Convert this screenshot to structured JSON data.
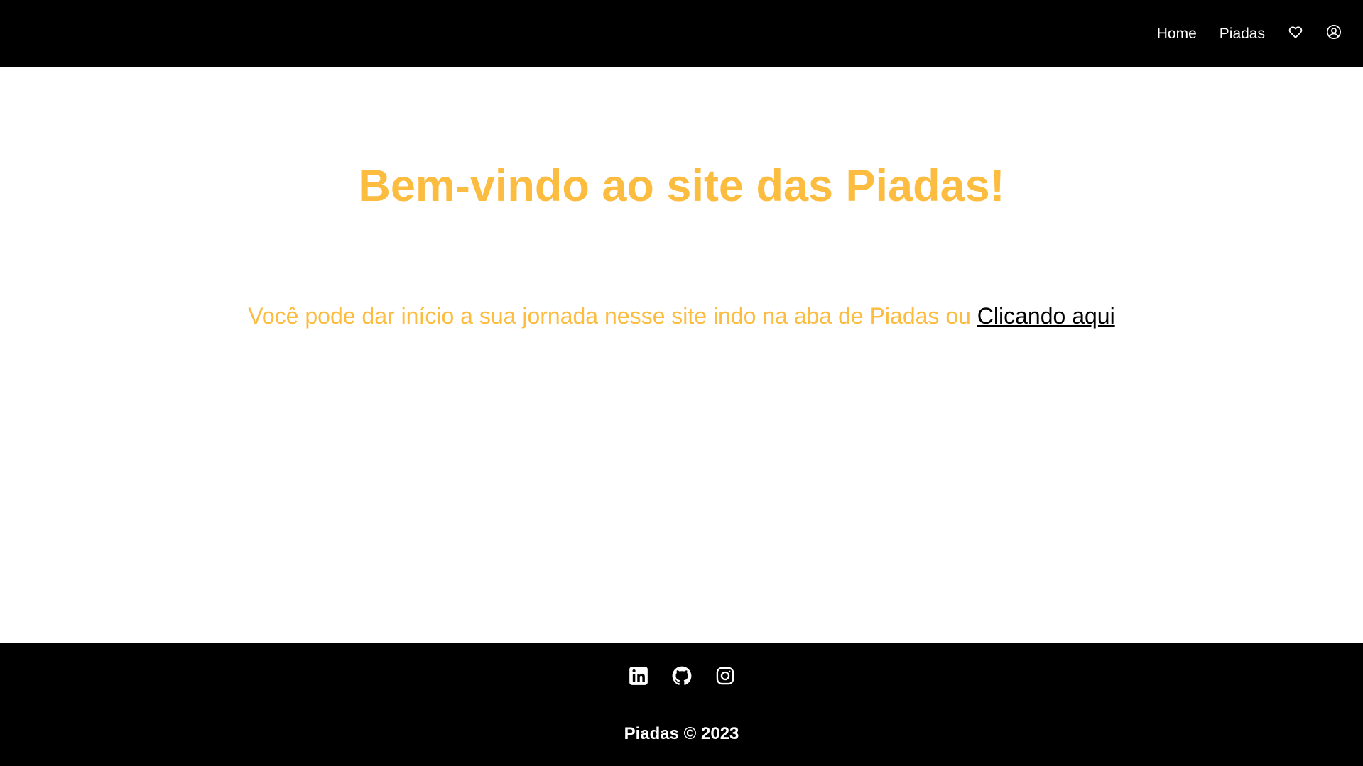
{
  "header": {
    "nav": {
      "home_label": "Home",
      "piadas_label": "Piadas",
      "favorites_icon": "heart-icon",
      "profile_icon": "user-circle-icon"
    }
  },
  "main": {
    "headline": "Bem-vindo ao site das Piadas!",
    "intro_text": "Você pode dar início a sua jornada nesse site indo na aba de Piadas ou ",
    "intro_link": "Clicando aqui"
  },
  "footer": {
    "social": [
      "linkedin-icon",
      "github-icon",
      "instagram-icon"
    ],
    "copyright": "Piadas © 2023"
  },
  "colors": {
    "accent": "#fbbc3f",
    "bar_background": "#000000",
    "page_background": "#ffffff",
    "link": "#000000"
  }
}
